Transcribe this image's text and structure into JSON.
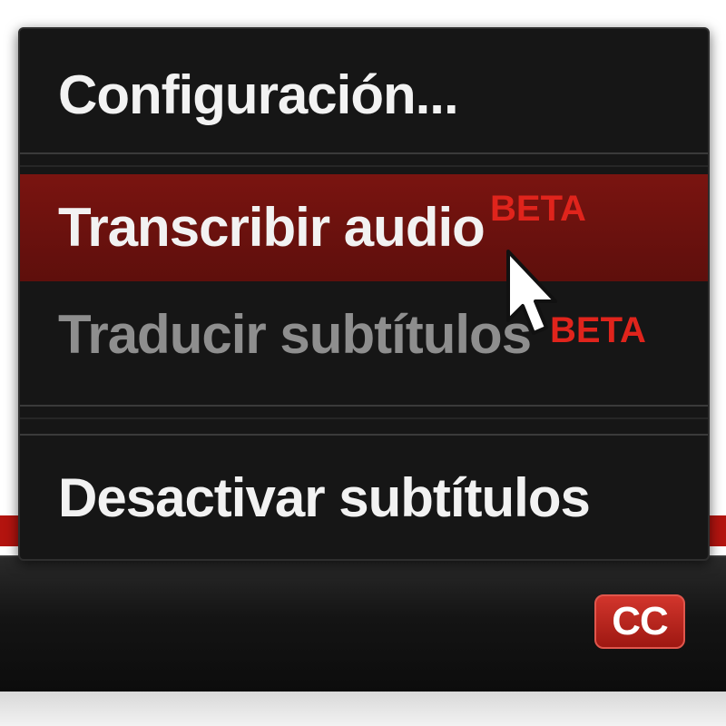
{
  "menu": {
    "items": [
      {
        "label": "Configuración...",
        "highlighted": false,
        "disabled": false
      },
      {
        "label": "Transcribir audio",
        "badge": "BETA",
        "highlighted": true,
        "disabled": false
      },
      {
        "label": "Traducir subtítulos",
        "badge": "BETA",
        "highlighted": false,
        "disabled": true
      },
      {
        "label": "Desactivar subtítulos",
        "highlighted": false,
        "disabled": false
      }
    ]
  },
  "controls": {
    "cc_label": "CC"
  },
  "colors": {
    "menu_bg": "#161616",
    "highlight_bg": "#6e120e",
    "badge_red": "#e0241c",
    "progress_red": "#b3140f",
    "cc_red": "#c02a22",
    "disabled_text": "#8e8e8e"
  },
  "icons": {
    "cursor": "arrow-pointer-icon"
  }
}
